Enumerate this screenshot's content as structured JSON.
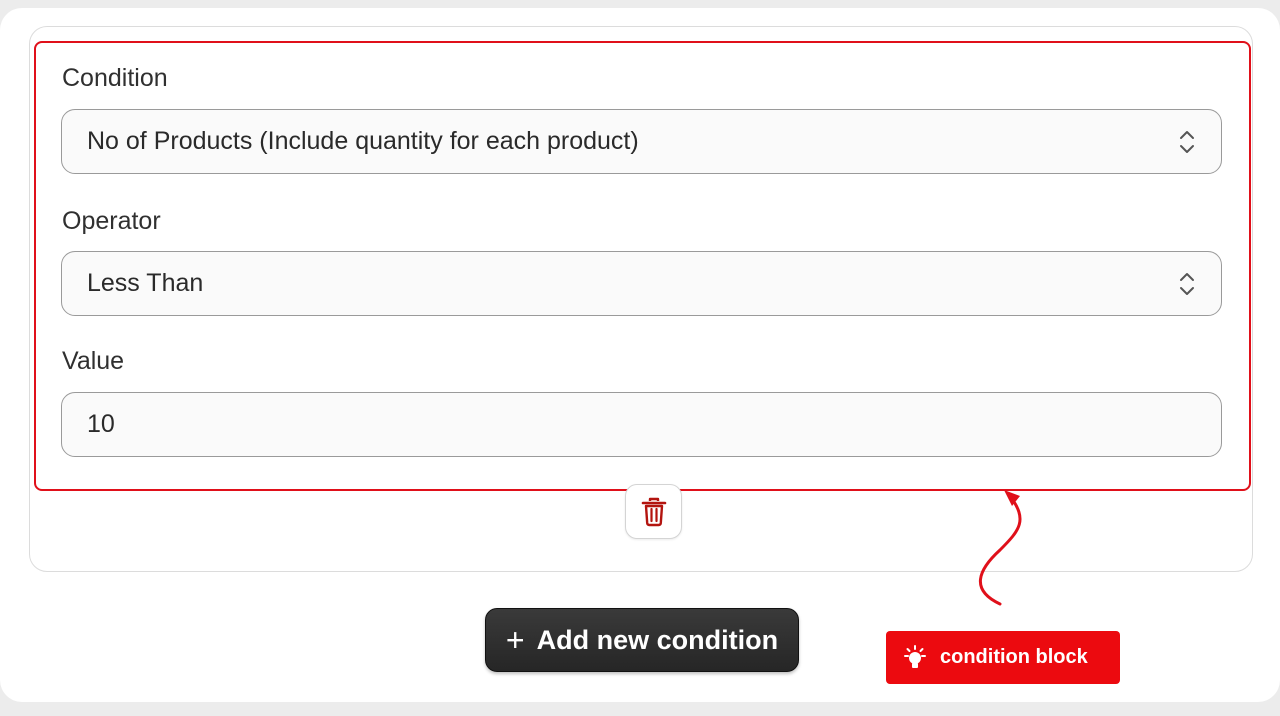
{
  "condition": {
    "label": "Condition",
    "selected": "No of Products (Include quantity for each product)"
  },
  "operator": {
    "label": "Operator",
    "selected": "Less Than"
  },
  "value": {
    "label": "Value",
    "input_value": "10"
  },
  "actions": {
    "delete_icon": "trash-icon",
    "add_label": "Add new condition",
    "add_icon": "plus-icon"
  },
  "annotation": {
    "callout_label": "condition block",
    "callout_icon": "lightbulb-icon",
    "accent_color": "#e0101a"
  }
}
